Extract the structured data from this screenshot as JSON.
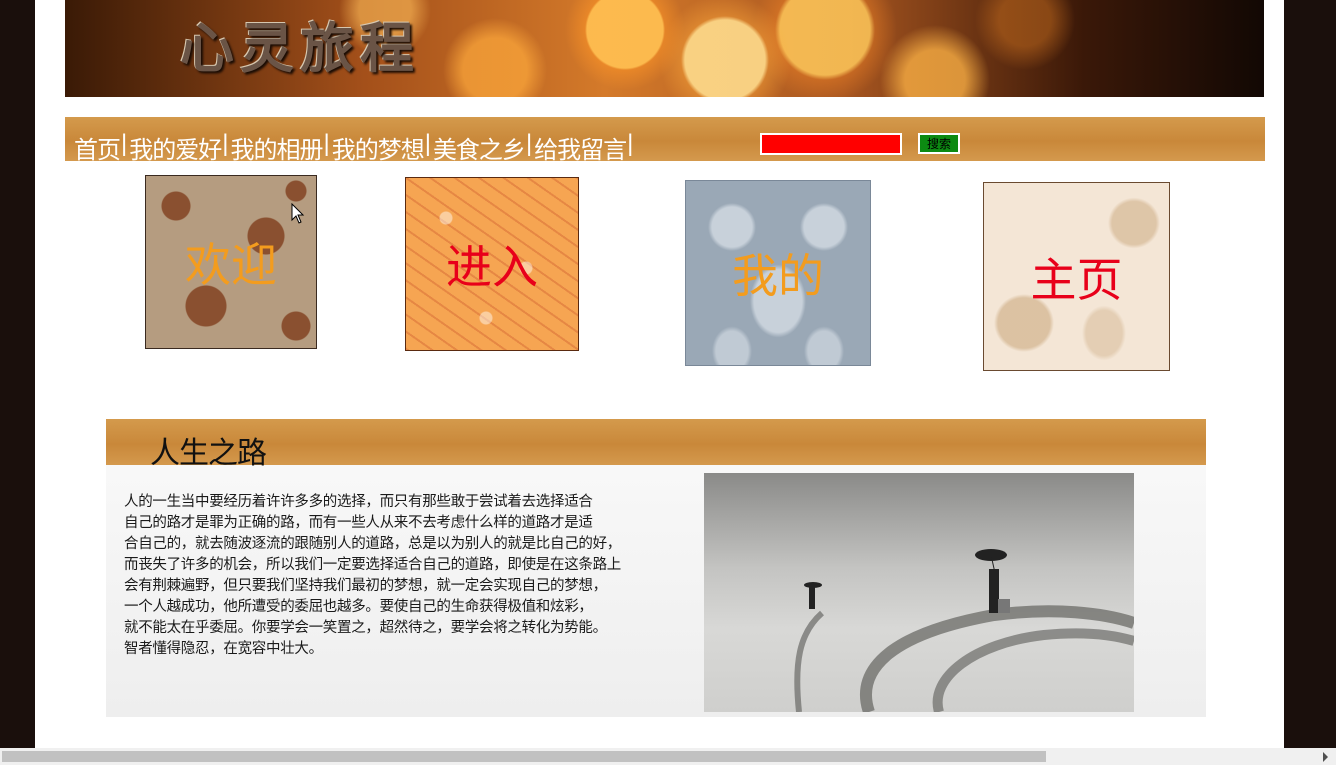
{
  "banner": {
    "title": "心灵旅程"
  },
  "nav": {
    "links": [
      "首页",
      "我的爱好",
      "我的相册",
      "我的梦想",
      "美食之乡",
      "给我留言"
    ],
    "separator": "|"
  },
  "search": {
    "value": "",
    "button_label": "搜索"
  },
  "tiles": [
    {
      "label": "欢迎",
      "color": "#f39c1e"
    },
    {
      "label": "进入",
      "color": "#e8001a"
    },
    {
      "label": "我的",
      "color": "#f39c1e"
    },
    {
      "label": "主页",
      "color": "#e8001a"
    }
  ],
  "section": {
    "title": "人生之路",
    "lines": [
      "人的一生当中要经历着许许多多的选择，而只有那些敢于尝试着去选择适合",
      "自己的路才是罪为正确的路，而有一些人从来不去考虑什么样的道路才是适",
      "合自己的，就去随波逐流的跟随别人的道路，总是以为别人的就是比自己的好，",
      "而丧失了许多的机会，所以我们一定要选择适合自己的道路，即使是在这条路上",
      "会有荆棘遍野，但只要我们坚持我们最初的梦想，就一定会实现自己的梦想，",
      "一个人越成功，他所遭受的委屈也越多。要使自己的生命获得极值和炫彩，",
      "就不能太在乎委屈。你要学会一笑置之，超然待之，要学会将之转化为势能。",
      "智者懂得隐忍，在宽容中壮大。"
    ]
  }
}
